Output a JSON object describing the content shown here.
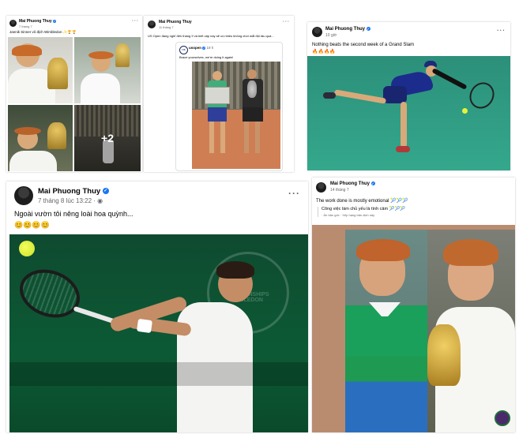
{
  "posts": [
    {
      "author": "Mai Phuong Thuy",
      "time": "7 tháng 7",
      "caption": "Jannik Sinner vô địch Wimbledon ✨🏆🏆",
      "photo_overlay": "+2"
    },
    {
      "author": "Mai Phuong Thuy",
      "time": "11 tháng 7",
      "caption": "US Open đang nghĩ đến tháng 9 và biết cập này sẽ có nhiều không chói mắt đội tâu quá...",
      "embedded": {
        "author": "usopen",
        "time": "19 h",
        "caption": "Brace yourselves, we're doing it again!"
      }
    },
    {
      "author": "Mai Phuong Thuy",
      "time": "10 giờ",
      "caption": "Nothing beats the second week of a Grand Slam",
      "emojis": "🔥🔥🔥🔥"
    },
    {
      "author": "Mai Phuong Thuy",
      "time": "7 tháng 8 lúc 13:22",
      "caption": "Ngoài vườn tôi nêng loài hoa quỳnh...",
      "emojis": "😊😊😊😊",
      "watermark": "THE CHAMPIONSHIPS WIMBLEDON"
    },
    {
      "author": "Mai Phuong Thuy",
      "time": "14 tháng 7",
      "caption": "The work done is mostly emotional 🎾🎾🎾",
      "translation": "Công việc làm chủ yếu là tình cảm 🎾🎾🎾",
      "translation_note": "· Ẩn bản gốc · Xếp hạng bản dịch này"
    }
  ],
  "colors": {
    "facebook_blue": "#1877f2",
    "wimbledon_green": "#0c5a35",
    "hard_court_teal": "#2f9a84",
    "clay": "#c8714a"
  }
}
